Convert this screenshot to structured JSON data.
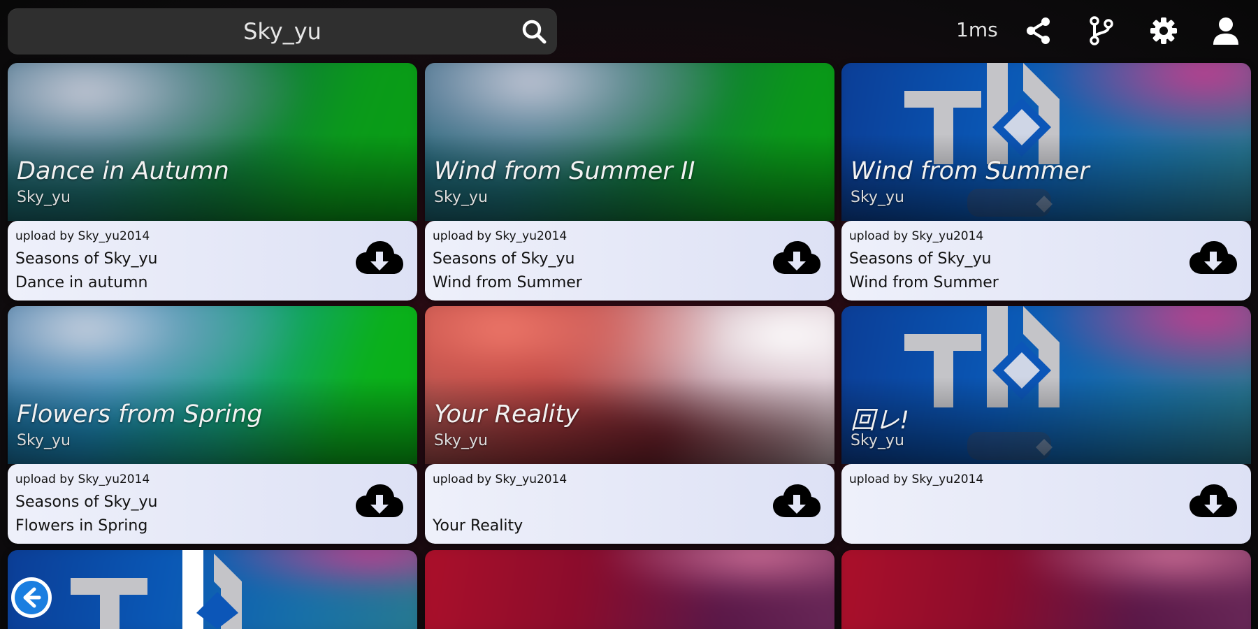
{
  "search": {
    "query": "Sky_yu"
  },
  "status": {
    "latency": "1ms"
  },
  "icons": {
    "search": "search-icon",
    "share": "share-icon",
    "branch": "branch-icon",
    "settings": "gear-icon",
    "user": "user-icon",
    "download": "cloud-download-icon",
    "back": "arrow-left-icon"
  },
  "colors": {
    "card_info_bg": "#e4e7f7",
    "search_bg": "#2f2f2f"
  },
  "cards": [
    {
      "title": "Dance in Autumn",
      "artist": "Sky_yu",
      "uploader": "upload by Sky_yu2014",
      "line1": "Seasons of Sky_yu",
      "line2": "Dance in autumn"
    },
    {
      "title": "Wind from Summer II",
      "artist": "Sky_yu",
      "uploader": "upload by Sky_yu2014",
      "line1": "Seasons of Sky_yu",
      "line2": "Wind from Summer"
    },
    {
      "title": "Wind from Summer",
      "artist": "Sky_yu",
      "uploader": "upload by Sky_yu2014",
      "line1": "Seasons of Sky_yu",
      "line2": "Wind from Summer"
    },
    {
      "title": "Flowers from Spring",
      "artist": "Sky_yu",
      "uploader": "upload by Sky_yu2014",
      "line1": "Seasons of Sky_yu",
      "line2": "Flowers in Spring"
    },
    {
      "title": "Your Reality",
      "artist": "Sky_yu",
      "uploader": "upload by Sky_yu2014",
      "line1": "",
      "line2": "Your Reality"
    },
    {
      "title": "回レ!",
      "artist": "Sky_yu",
      "uploader": "upload by Sky_yu2014",
      "line1": "",
      "line2": ""
    }
  ]
}
